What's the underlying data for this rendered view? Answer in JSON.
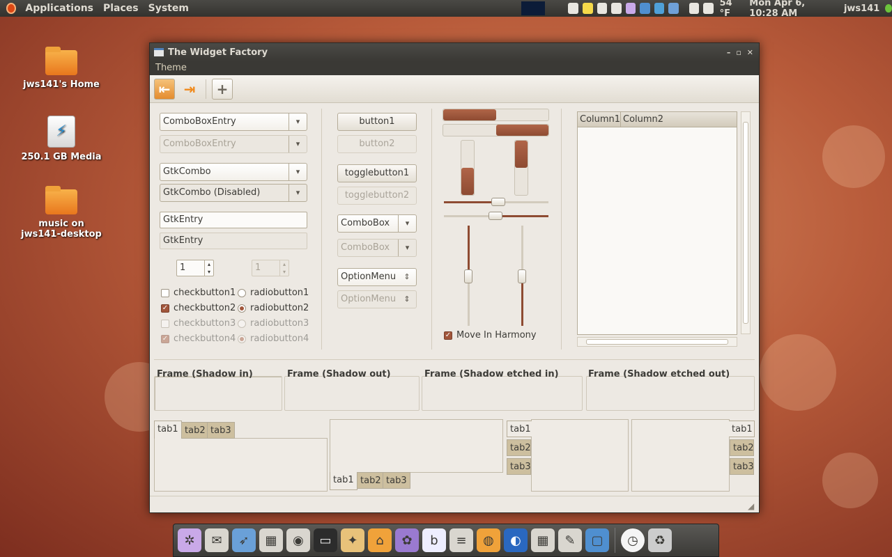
{
  "panel": {
    "menus": [
      "Applications",
      "Places",
      "System"
    ],
    "temperature": "54 °F",
    "datetime": "Mon Apr  6, 10:28 AM",
    "user": "jws141"
  },
  "desktop": {
    "icons": [
      {
        "label": "jws141's Home"
      },
      {
        "label": "250.1 GB Media"
      },
      {
        "label": "music on jws141-desktop"
      }
    ]
  },
  "window": {
    "title": "The Widget Factory",
    "menu": "Theme",
    "combos": [
      "ComboBoxEntry",
      "ComboBoxEntry",
      "GtkCombo",
      "GtkCombo (Disabled)"
    ],
    "entries": [
      "GtkEntry",
      "GtkEntry"
    ],
    "spin": [
      "1",
      "1"
    ],
    "checks": [
      "checkbutton1",
      "checkbutton2",
      "checkbutton3",
      "checkbutton4"
    ],
    "radios": [
      "radiobutton1",
      "radiobutton2",
      "radiobutton3",
      "radiobutton4"
    ],
    "buttons": [
      "button1",
      "button2",
      "togglebutton1",
      "togglebutton2"
    ],
    "mid_combos": [
      "ComboBox",
      "ComboBox",
      "OptionMenu",
      "OptionMenu"
    ],
    "move_harmony": "Move In Harmony",
    "tree": {
      "columns": [
        "Column1",
        "Column2"
      ]
    },
    "frames": [
      "Frame (Shadow in)",
      "Frame (Shadow out)",
      "Frame (Shadow etched in)",
      "Frame (Shadow etched out)"
    ],
    "tabs": [
      "tab1",
      "tab2",
      "tab3"
    ],
    "progress": {
      "h1": 0.5,
      "h2": 0.5,
      "v1": 0.5,
      "v2": 0.5
    }
  }
}
